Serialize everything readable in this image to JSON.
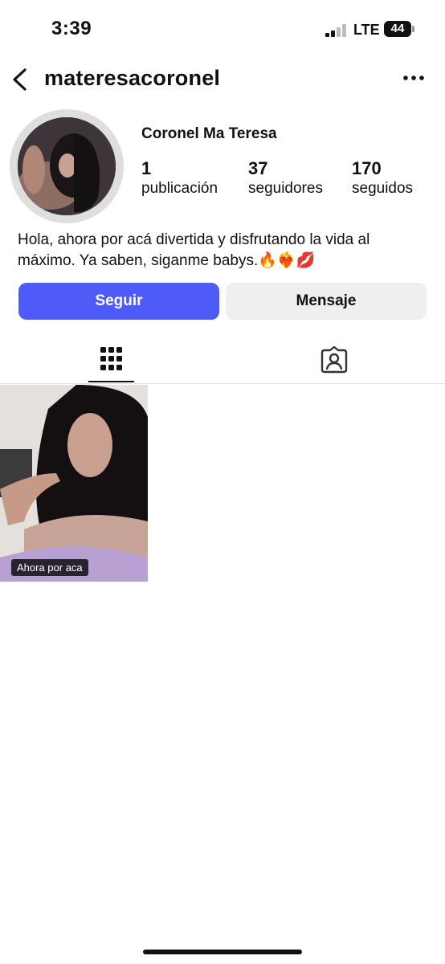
{
  "status_bar": {
    "time": "3:39",
    "network": "LTE",
    "battery": "44"
  },
  "header": {
    "username": "materesacoronel",
    "back_icon": "chevron-left-icon",
    "more_icon": "ellipsis-icon"
  },
  "profile": {
    "full_name": "Coronel Ma Teresa",
    "stats": [
      {
        "value": "1",
        "label": "publicación"
      },
      {
        "value": "37",
        "label": "seguidores"
      },
      {
        "value": "170",
        "label": "seguidos"
      }
    ],
    "bio": "Hola, ahora por acá divertida y disfrutando la vida al máximo. Ya saben, siganme babys.🔥❤️‍🔥💋"
  },
  "actions": {
    "follow": "Seguir",
    "message": "Mensaje"
  },
  "colors": {
    "follow_button": "#4f5bf7",
    "message_button": "#efeff1"
  },
  "tabs": [
    {
      "icon": "grid-icon",
      "active": true
    },
    {
      "icon": "tagged-icon",
      "active": false
    }
  ],
  "posts": [
    {
      "label": "Ahora por aca"
    }
  ]
}
